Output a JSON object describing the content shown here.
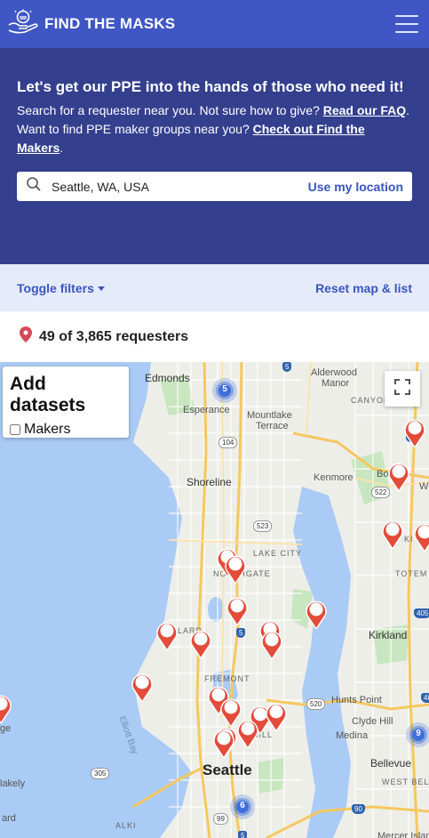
{
  "nav": {
    "title": "FIND THE MASKS",
    "logo_icon": "hands-mask-icon",
    "menu_icon": "hamburger-icon"
  },
  "hero": {
    "heading": "Let's get our PPE into the hands of those who need it!",
    "line1_prefix": "Search for a requester near you. Not sure how to give?",
    "faq_link": "Read our FAQ",
    "line1_suffix": ".",
    "line2_prefix": "Want to find PPE maker groups near you?",
    "makers_link": "Check out Find the Makers",
    "line2_suffix": "."
  },
  "search": {
    "value": "Seattle, WA, USA",
    "use_location": "Use my location",
    "icon": "search-icon"
  },
  "filters": {
    "toggle": "Toggle filters",
    "reset": "Reset map & list"
  },
  "results": {
    "count_text": "49 of 3,865 requesters",
    "icon": "map-pin-icon"
  },
  "map": {
    "datasets_title": "Add datasets",
    "makers_label": "Makers",
    "makers_checked": false,
    "clusters": [
      {
        "count": "5"
      },
      {
        "count": "9"
      },
      {
        "count": "6"
      }
    ],
    "labels": {
      "edmonds": "Edmonds",
      "alderwood": "Alderwood",
      "manor": "Manor",
      "canyon": "CANYON",
      "esperance": "Esperance",
      "mountlake": "Mountlake",
      "terrace": "Terrace",
      "shoreline": "Shoreline",
      "kenmore": "Kenmore",
      "bo": "Bo",
      "lake_city": "LAKE CITY",
      "northgate": "NORTHGATE",
      "totem": "TOTEM",
      "ballard": "BALLARD",
      "fremont": "FREMONT",
      "kirkland": "Kirkland",
      "hunts_point": "Hunts Point",
      "clyde_hill": "Clyde Hill",
      "medina": "Medina",
      "elliott_bay": "Elliott Bay",
      "seattle": "Seattle",
      "bellevue": "Bellevue",
      "west_bellevue": "WEST BELLEV",
      "ge": "ge",
      "lakely": "lakely",
      "ard": "ard",
      "alki": "ALKI",
      "mercer": "Mercer Island",
      "ki": "KI",
      "w": "W",
      "capitol_hill": "HILL"
    },
    "shields": {
      "r5a": "5",
      "r104": "104",
      "r523": "523",
      "r522": "522",
      "r5b": "5",
      "r520": "520",
      "r405a": "405",
      "r405b": "405",
      "r305": "305",
      "r99": "99",
      "r5c": "5",
      "r90": "90",
      "r5d": "5"
    },
    "colors": {
      "water": "#aacbf5",
      "land": "#eeeee9",
      "park": "#c8e6c0",
      "road": "#f9d77c",
      "pin": "#e34b3a",
      "cluster": "#3f6fd8"
    }
  }
}
